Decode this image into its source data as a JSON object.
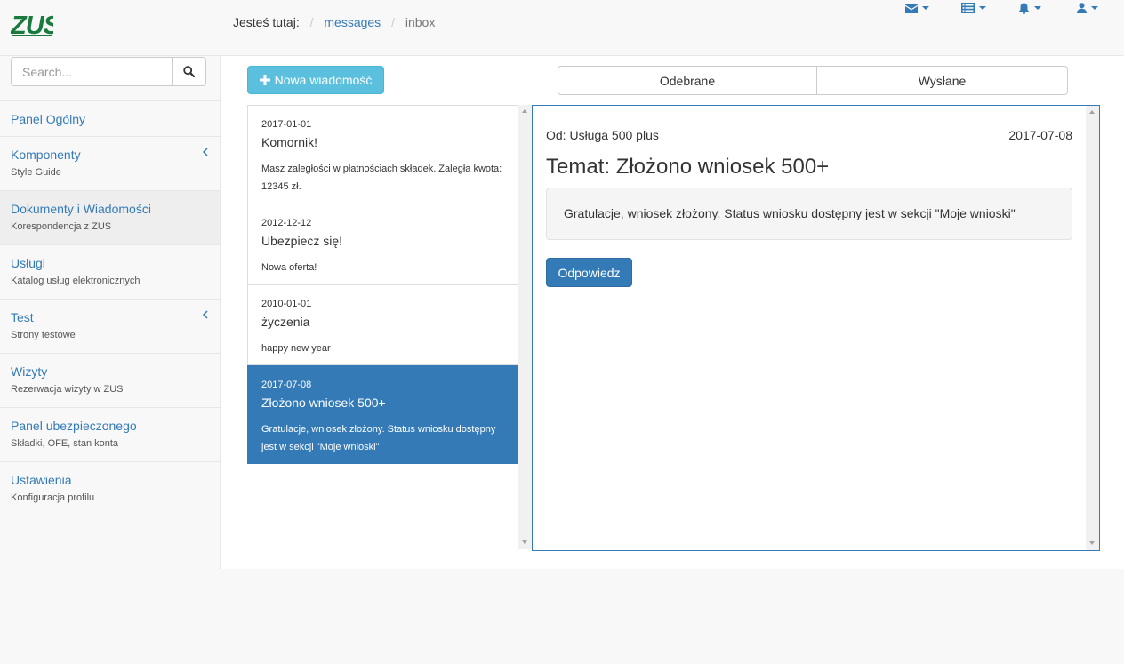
{
  "brand": {
    "logo_text": "ZUS",
    "color": "#1a7a3e"
  },
  "breadcrumb": {
    "label": "Jesteś tutaj:",
    "link": "messages",
    "current": "inbox"
  },
  "nav_icons": [
    "envelope-icon",
    "list-icon",
    "bell-icon",
    "user-icon"
  ],
  "search": {
    "placeholder": "Search..."
  },
  "sidebar": {
    "items": [
      {
        "title": "Panel Ogólny",
        "subtitle": ""
      },
      {
        "title": "Komponenty",
        "subtitle": "Style Guide",
        "has_submenu": true
      },
      {
        "title": "Dokumenty i Wiadomości",
        "subtitle": "Korespondencja z ZUS",
        "active": true
      },
      {
        "title": "Usługi",
        "subtitle": "Katalog usług elektronicznych"
      },
      {
        "title": "Test",
        "subtitle": "Strony testowe",
        "has_submenu": true
      },
      {
        "title": "Wizyty",
        "subtitle": "Rezerwacja wizyty w ZUS"
      },
      {
        "title": "Panel ubezpieczonego",
        "subtitle": "Składki, OFE, stan konta"
      },
      {
        "title": "Ustawienia",
        "subtitle": "Konfiguracja profilu"
      }
    ]
  },
  "toolbar": {
    "new_message": "Nowa wiadomość"
  },
  "tabs": {
    "received": "Odebrane",
    "sent": "Wysłane"
  },
  "messages": [
    {
      "date": "2017-01-01",
      "subject": "Komornik!",
      "preview": "Masz zaległości w płatnościach składek. Zaległa kwota: 12345 zł."
    },
    {
      "date": "2012-12-12",
      "subject": "Ubezpiecz się!",
      "preview": "Nowa oferta!"
    },
    {
      "date": "2010-01-01",
      "subject": "życzenia",
      "preview": "happy new year"
    },
    {
      "date": "2017-07-08",
      "subject": "Złożono wniosek 500+",
      "preview": "Gratulacje, wniosek złożony. Status wniosku dostępny jest w sekcji \"Moje wnioski\"",
      "selected": true
    }
  ],
  "detail": {
    "from": "Od: Usługa 500 plus",
    "date": "2017-07-08",
    "subject": "Temat: Złożono wniosek 500+",
    "body": "Gratulacje, wniosek złożony. Status wniosku dostępny jest w sekcji \"Moje wnioski\"",
    "reply": "Odpowiedz"
  },
  "colors": {
    "primary": "#337ab7",
    "info": "#5bc0de"
  }
}
